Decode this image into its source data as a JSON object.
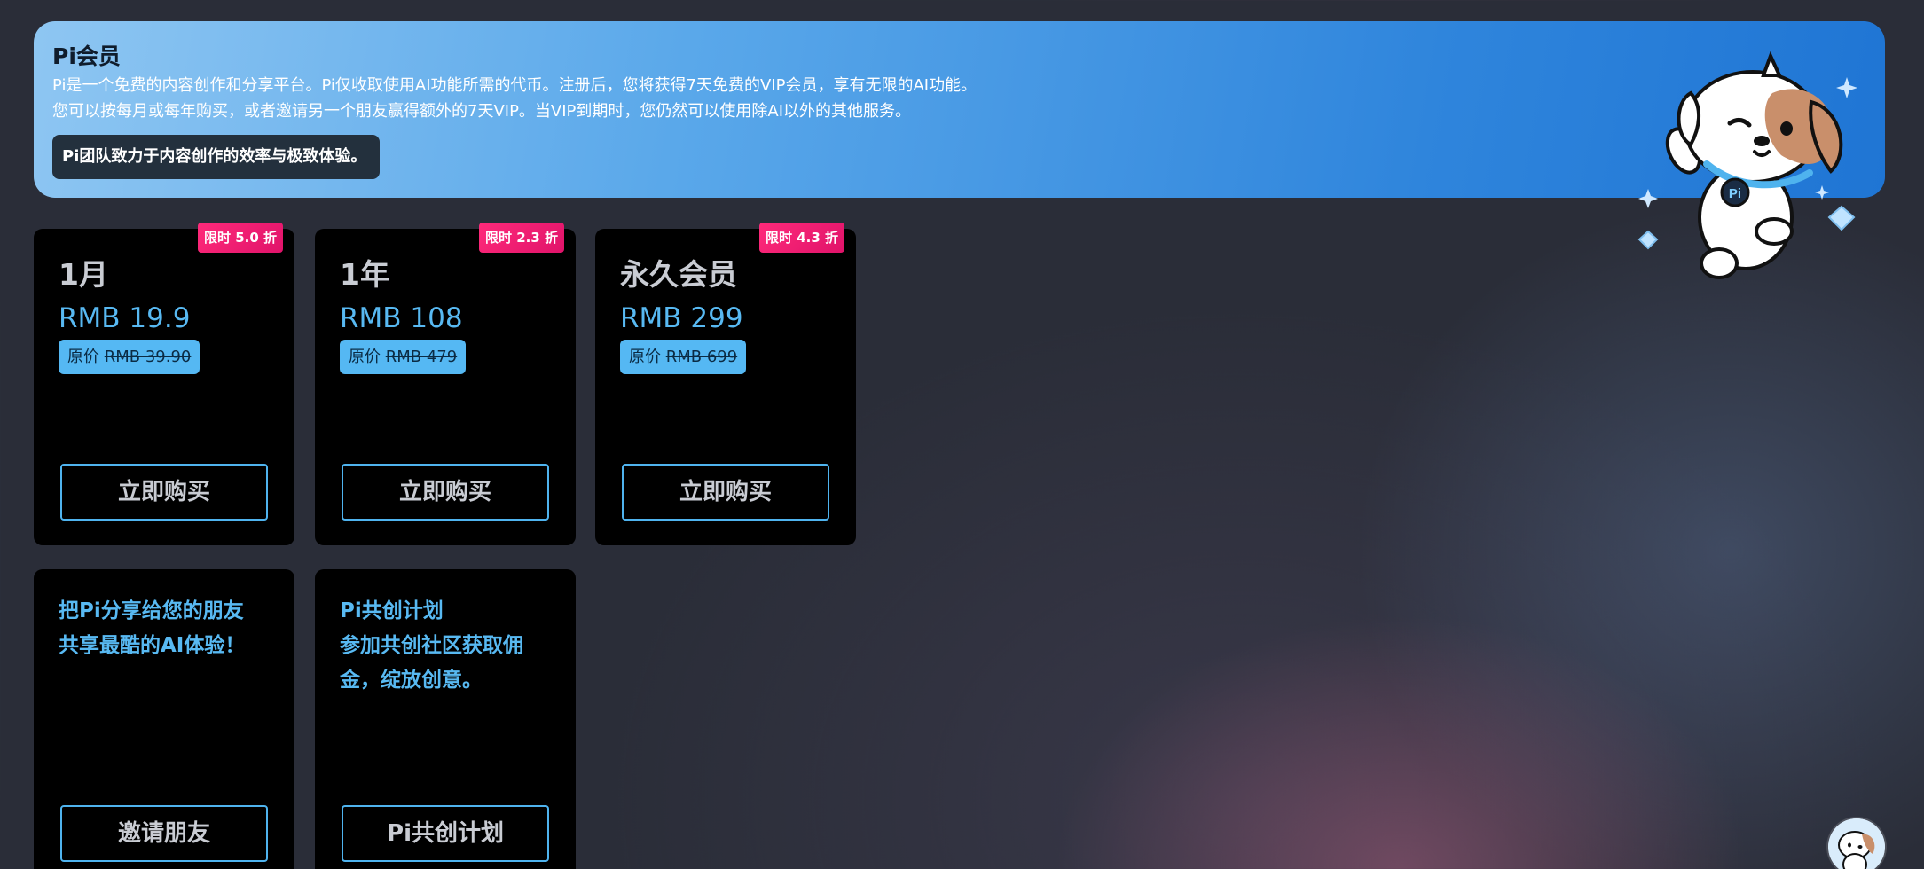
{
  "banner": {
    "title": "Pi会员",
    "desc_line1": "Pi是一个免费的内容创作和分享平台。Pi仅收取使用AI功能所需的代币。注册后，您将获得7天免费的VIP会员，享有无限的AI功能。",
    "desc_line2": "您可以按每月或每年购买，或者邀请另一个朋友赢得额外的7天VIP。当VIP到期时，您仍然可以使用除AI以外的其他服务。",
    "tagline": "Pi团队致力于内容创作的效率与极致体验。",
    "mascot": "pi-dog-mascot",
    "mascot_collar_text": "Pi"
  },
  "plans": [
    {
      "badge": "限时 5.0 折",
      "name": "1月",
      "price": "RMB 19.9",
      "orig_prefix": "原价 ",
      "orig_price": "RMB 39.90",
      "button": "立即购买"
    },
    {
      "badge": "限时 2.3 折",
      "name": "1年",
      "price": "RMB 108",
      "orig_prefix": "原价 ",
      "orig_price": "RMB 479",
      "button": "立即购买"
    },
    {
      "badge": "限时 4.3 折",
      "name": "永久会员",
      "price": "RMB 299",
      "orig_prefix": "原价 ",
      "orig_price": "RMB 699",
      "button": "立即购买"
    }
  ],
  "promos": [
    {
      "lines": [
        "把Pi分享给您的朋友",
        "共享最酷的AI体验！"
      ],
      "button": "邀请朋友"
    },
    {
      "lines": [
        "Pi共创计划",
        "参加共创社区获取佣",
        "金，绽放创意。"
      ],
      "button": "Pi共创计划"
    }
  ],
  "colors": {
    "background": "#2a2d38",
    "banner_gradient_start": "#8ec6f2",
    "banner_gradient_end": "#1f75d4",
    "card_background": "#000000",
    "accent_blue": "#58b9f2",
    "badge_pink": "#e0136a"
  },
  "corner_avatar": "pi-dog-avatar-icon"
}
